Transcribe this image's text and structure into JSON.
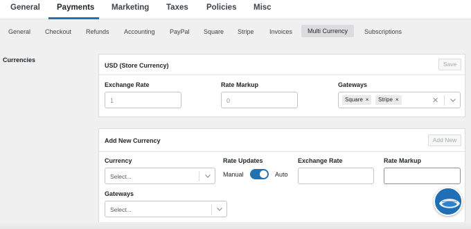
{
  "top_tabs": [
    {
      "label": "General"
    },
    {
      "label": "Payments"
    },
    {
      "label": "Marketing"
    },
    {
      "label": "Taxes"
    },
    {
      "label": "Policies"
    },
    {
      "label": "Misc"
    }
  ],
  "active_top_tab": "Payments",
  "sub_tabs": [
    {
      "label": "General"
    },
    {
      "label": "Checkout"
    },
    {
      "label": "Refunds"
    },
    {
      "label": "Accounting"
    },
    {
      "label": "PayPal"
    },
    {
      "label": "Square"
    },
    {
      "label": "Stripe"
    },
    {
      "label": "Invoices"
    },
    {
      "label": "Multi Currency"
    },
    {
      "label": "Subscriptions"
    }
  ],
  "active_sub_tab": "Multi Currency",
  "section_label": "Currencies",
  "store_currency": {
    "title": "USD (Store Currency)",
    "save_label": "Save",
    "exchange_rate_label": "Exchange Rate",
    "exchange_rate_value": "1",
    "rate_markup_label": "Rate Markup",
    "rate_markup_value": "0",
    "gateways_label": "Gateways",
    "gateways": [
      "Square",
      "Stripe"
    ],
    "chip_remove": "×",
    "clear": "✕"
  },
  "new_currency": {
    "title": "Add New Currency",
    "add_label": "Add New",
    "currency_label": "Currency",
    "currency_placeholder": "Select...",
    "rate_updates_label": "Rate Updates",
    "manual_label": "Manual",
    "auto_label": "Auto",
    "auto_enabled": true,
    "exchange_rate_label": "Exchange Rate",
    "exchange_rate_value": "",
    "rate_markup_label": "Rate Markup",
    "rate_markup_value": "",
    "gateways_label": "Gateways",
    "gateways_placeholder": "Select..."
  },
  "colors": {
    "accent": "#2271b1",
    "background": "#f0f0f1",
    "card": "#ffffff",
    "fab": "#1e6fb4"
  },
  "icons": {
    "dropdown": "chevron-down-icon",
    "fab": "help-assistant-icon"
  }
}
